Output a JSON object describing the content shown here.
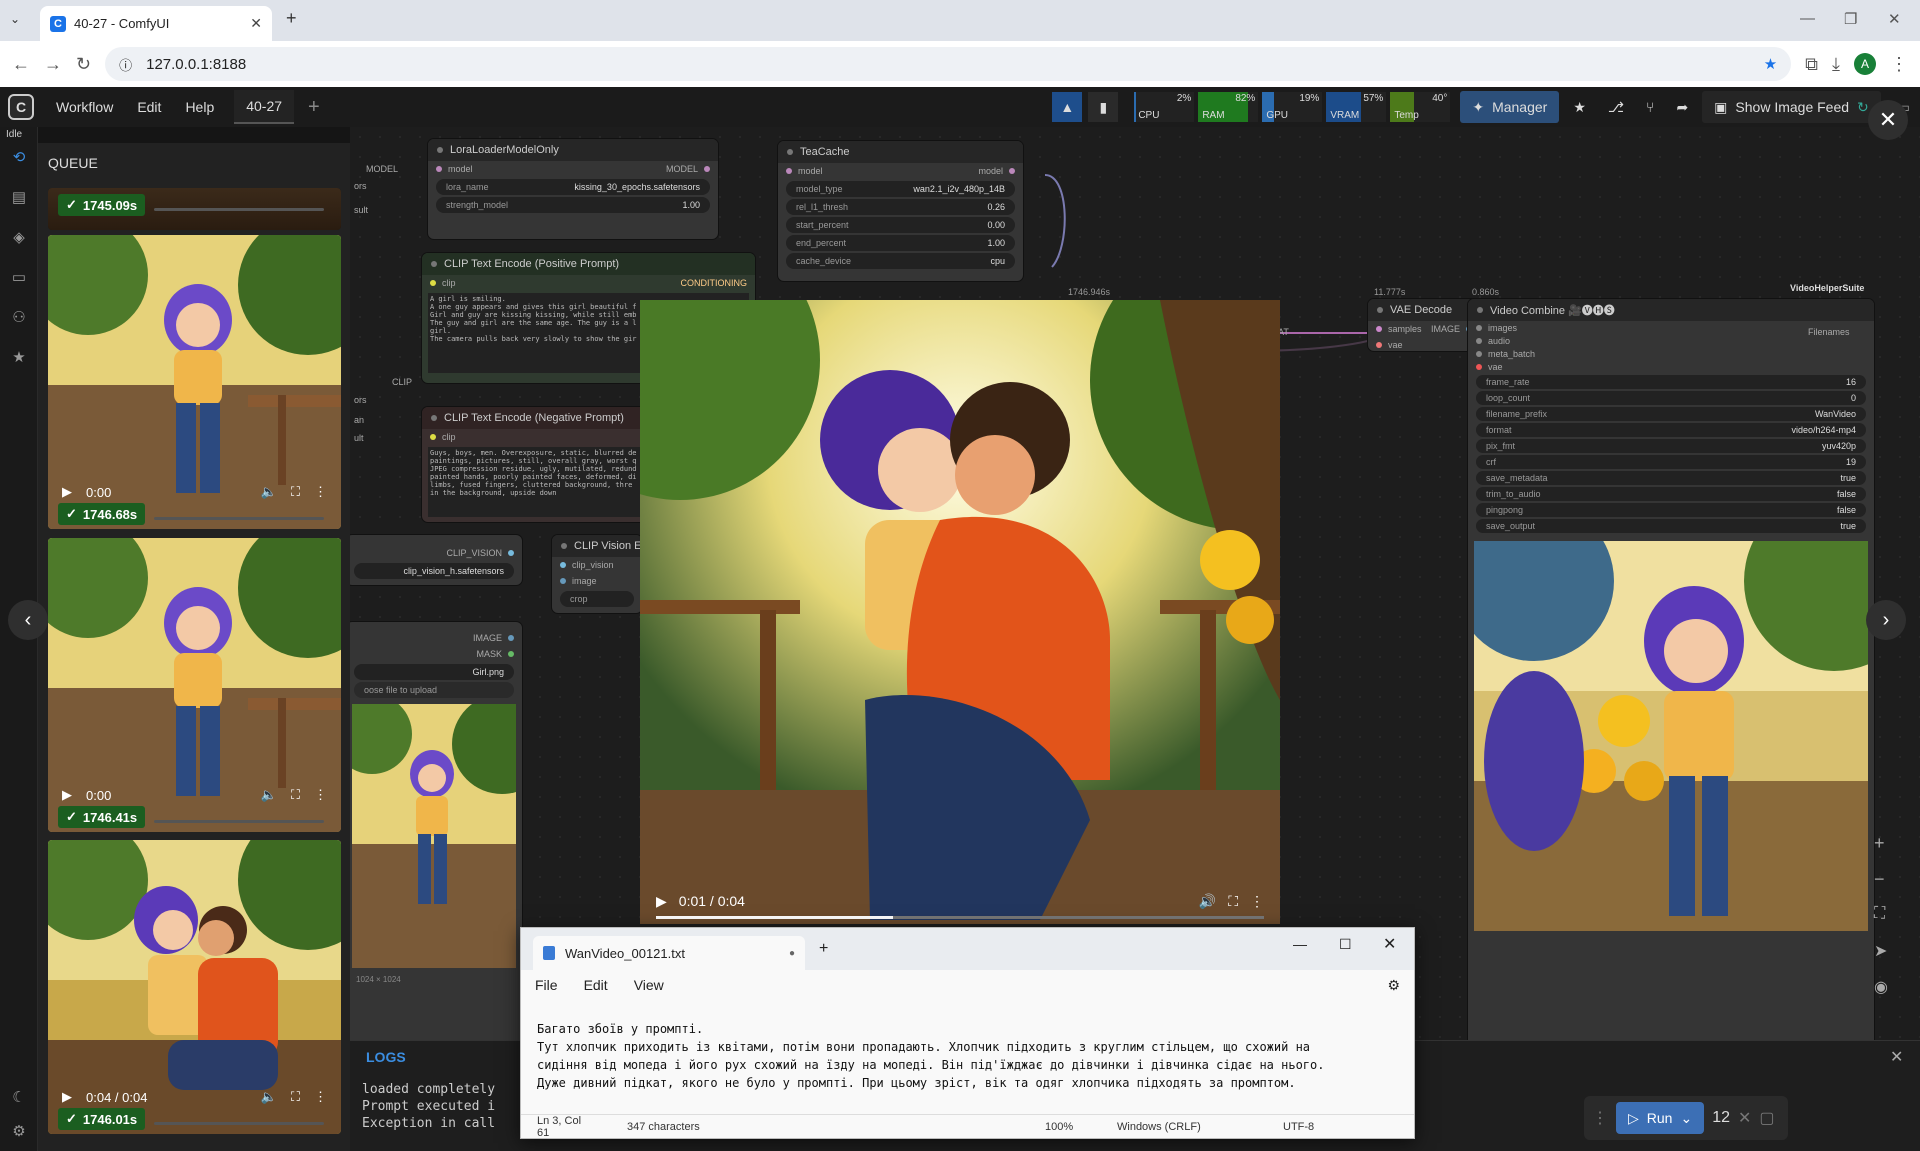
{
  "browser": {
    "tab_title": "40-27 - ComfyUI",
    "url": "127.0.0.1:8188",
    "profile_initial": "A"
  },
  "app": {
    "status": "Idle",
    "menus": [
      "Workflow",
      "Edit",
      "Help"
    ],
    "workflow_tab": "40-27",
    "stats": [
      {
        "label": "CPU",
        "value": "2%",
        "level": 0.02,
        "color": "#2b6cb0"
      },
      {
        "label": "RAM",
        "value": "82%",
        "level": 0.82,
        "color": "#1f7a1f"
      },
      {
        "label": "GPU",
        "value": "19%",
        "level": 0.19,
        "color": "#2b6cb0"
      },
      {
        "label": "VRAM",
        "value": "57%",
        "level": 0.57,
        "color": "#1c4c8a"
      },
      {
        "label": "Temp",
        "value": "40°",
        "level": 0.4,
        "color": "#4d7a1a"
      }
    ],
    "manager_label": "Manager",
    "show_image_feed_label": "Show Image Feed"
  },
  "queue": {
    "title": "QUEUE",
    "items": [
      {
        "time": "1745.09s",
        "video_time": ""
      },
      {
        "time": "1746.68s",
        "video_time": "0:00"
      },
      {
        "time": "1746.41s",
        "video_time": "0:00"
      },
      {
        "time": "1746.01s",
        "video_time": "0:04 / 0:04"
      }
    ]
  },
  "nodes": {
    "lora": {
      "title": "LoraLoaderModelOnly",
      "in_model": "model",
      "out_model": "MODEL",
      "left_model": "MODEL",
      "lora_name_label": "lora_name",
      "lora_name": "kissing_30_epochs.safetensors",
      "strength_label": "strength_model",
      "strength": "1.00",
      "left_ors": "ors",
      "left_sult": "sult"
    },
    "teacache": {
      "title": "TeaCache",
      "in_model": "model",
      "out_model": "model",
      "widgets": [
        {
          "label": "model_type",
          "value": "wan2.1_i2v_480p_14B"
        },
        {
          "label": "rel_l1_thresh",
          "value": "0.26"
        },
        {
          "label": "start_percent",
          "value": "0.00"
        },
        {
          "label": "end_percent",
          "value": "1.00"
        },
        {
          "label": "cache_device",
          "value": "cpu"
        }
      ]
    },
    "clip_pos": {
      "title": "CLIP Text Encode (Positive Prompt)",
      "in": "clip",
      "out": "CONDITIONING",
      "text": "A girl is smiling.\nA one guy appears and gives this girl beautiful f\nGirl and guy are kissing kissing, while still emb\nThe guy and girl are the same age. The guy is a l\ngirl.\nThe camera pulls back very slowly to show the gir"
    },
    "clip_neg": {
      "title": "CLIP Text Encode (Negative Prompt)",
      "in": "clip",
      "text": "Guys, boys, men. Overexposure, static, blurred de\npaintings, pictures, still, overall gray, worst q\nJPEG compression residue, ugly, mutilated, redund\npainted hands, poorly painted faces, deformed, di\nlimbs, fused fingers, cluttered background, thre\nin the background, upside down"
    },
    "clip_side": {
      "clip": "CLIP",
      "an": "an",
      "ors": "ors",
      "ult": "ult"
    },
    "clip_vision": {
      "title": "CLIP Vision E",
      "in_clip_vision": "clip_vision",
      "in_image": "image",
      "in_crop": "crop",
      "left_label": "CLIP_VISION",
      "left_value": "clip_vision_h.safetensors"
    },
    "load_image": {
      "image_out": "IMAGE",
      "mask_out": "MASK",
      "file": "Girl.png",
      "upload": "oose file to upload",
      "size": "1024 × 1024"
    },
    "vae_decode": {
      "title": "VAE Decode",
      "time": "11.777s",
      "in_samples": "samples",
      "in_vae": "vae",
      "out": "IMAGE",
      "left": "AT"
    },
    "ksampler_time": "1746.946s",
    "video_combine": {
      "title": "Video Combine 🎥🅥🅗🅢",
      "time": "0.860s",
      "suite": "VideoHelperSuite",
      "out": "Filenames",
      "inputs": [
        "images",
        "audio",
        "meta_batch",
        "vae"
      ],
      "widgets": [
        {
          "label": "frame_rate",
          "value": "16"
        },
        {
          "label": "loop_count",
          "value": "0"
        },
        {
          "label": "filename_prefix",
          "value": "WanVideo"
        },
        {
          "label": "format",
          "value": "video/h264-mp4"
        },
        {
          "label": "pix_fmt",
          "value": "yuv420p"
        },
        {
          "label": "crf",
          "value": "19"
        },
        {
          "label": "save_metadata",
          "value": "true"
        },
        {
          "label": "trim_to_audio",
          "value": "false"
        },
        {
          "label": "pingpong",
          "value": "false"
        },
        {
          "label": "save_output",
          "value": "true"
        }
      ]
    }
  },
  "viewer": {
    "time": "0:01 / 0:04",
    "progress": 0.39
  },
  "logs": {
    "title": "LOGS",
    "lines": "loaded completely\nPrompt executed i\nException in call"
  },
  "run": {
    "label": "Run",
    "batch": "12"
  },
  "notepad": {
    "filename": "WanVideo_00121.txt",
    "menus": [
      "File",
      "Edit",
      "View"
    ],
    "text": "Багато збоїв у промпті.\nТут хлопчик приходить із квітами, потім вони пропадають. Хлопчик підходить з круглим стільцем, що схожий на\nсидіння від мопеда і його рух схожий на їзду на мопеді. Він під'їжджає до дівчинки і дівчинка сідає на нього.\nДуже дивний підкат, якого не було у промпті. При цьому зріст, вік та одяг хлопчика підходять за промптом.",
    "status": {
      "position": "Ln 3, Col 61",
      "chars": "347 characters",
      "zoom": "100%",
      "eol": "Windows (CRLF)",
      "encoding": "UTF-8"
    }
  }
}
